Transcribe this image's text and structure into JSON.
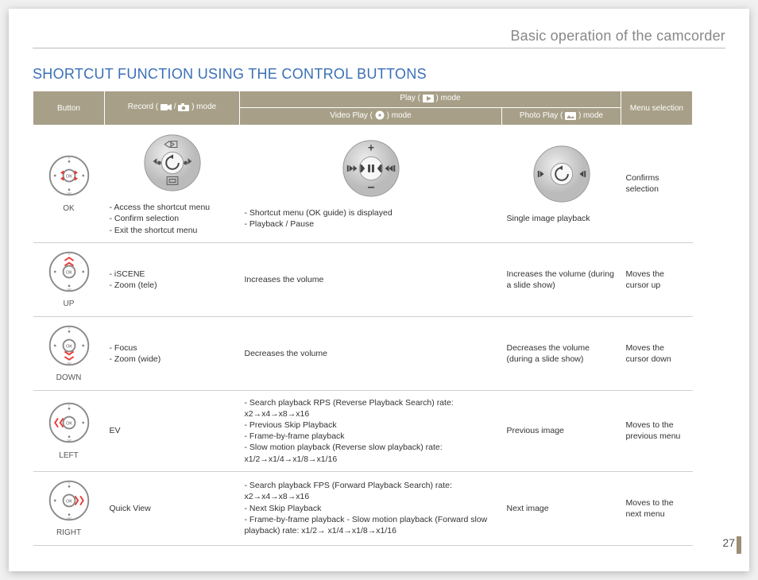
{
  "chapter_title": "Basic operation of the camcorder",
  "section_title": "SHORTCUT FUNCTION USING THE CONTROL BUTTONS",
  "page_number": "27",
  "headers": {
    "button": "Button",
    "record": "Record (",
    "record_tail": " ) mode",
    "play": "Play (",
    "play_tail": " ) mode",
    "video_play": "Video Play (",
    "video_play_tail": " ) mode",
    "photo_play": "Photo Play (",
    "photo_play_tail": " ) mode",
    "menu": "Menu selection"
  },
  "rows": [
    {
      "button": "OK",
      "record": [
        "Access the shortcut menu",
        "Confirm selection",
        "Exit the shortcut menu"
      ],
      "video": [
        "Shortcut menu (OK guide) is displayed",
        "Playback / Pause"
      ],
      "photo": "Single image playback",
      "menu": "Confirms selection"
    },
    {
      "button": "UP",
      "record": [
        "iSCENE",
        "Zoom (tele)"
      ],
      "video_text": "Increases the volume",
      "photo": "Increases the volume (during a slide show)",
      "menu": "Moves the cursor up"
    },
    {
      "button": "DOWN",
      "record": [
        "Focus",
        "Zoom (wide)"
      ],
      "video_text": "Decreases the volume",
      "photo": "Decreases the volume (during a slide show)",
      "menu": "Moves the cursor down"
    },
    {
      "button": "LEFT",
      "record_text": "EV",
      "video": [
        "Search playback RPS (Reverse Playback Search) rate: x2→x4→x8→x16",
        "Previous Skip Playback",
        "Frame-by-frame playback",
        "Slow motion playback (Reverse slow playback) rate: x1/2→x1/4→x1/8→x1/16"
      ],
      "photo": "Previous image",
      "menu": "Moves to the previous menu"
    },
    {
      "button": "RIGHT",
      "record_text": "Quick View",
      "video": [
        "Search playback FPS (Forward Playback Search) rate: x2→x4→x8→x16",
        "Next Skip Playback",
        "Frame-by-frame playback - Slow motion playback (Forward slow playback) rate:  x1/2→ x1/4→x1/8→x1/16"
      ],
      "photo": "Next image",
      "menu": "Moves to the next menu"
    }
  ]
}
